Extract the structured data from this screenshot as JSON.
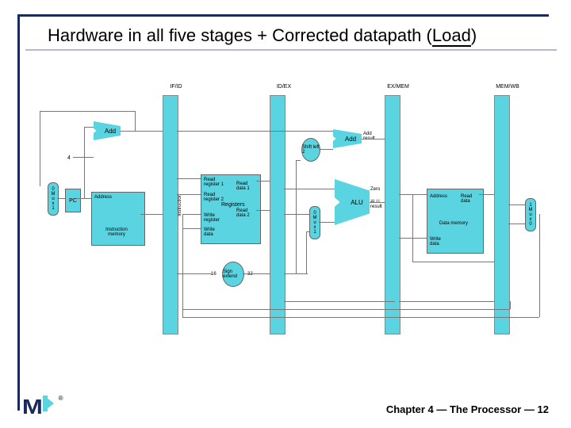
{
  "slide": {
    "title_prefix": "Hardware in all five stages + Corrected datapath (",
    "title_highlight": "Load",
    "title_suffix": ")",
    "footer": "Chapter 4 — The Processor — 12"
  },
  "pipeline": {
    "regs": [
      "IF/ID",
      "ID/EX",
      "EX/MEM",
      "MEM/WB"
    ]
  },
  "components": {
    "pc": "PC",
    "add1": "Add",
    "add2": "Add",
    "add_result": "Add result",
    "shift": "Shift left 2",
    "alu": "ALU",
    "alu_zero": "Zero",
    "alu_result": "ALU result",
    "instr_mem": "Instruction memory",
    "instr_mem_addr": "Address",
    "instr_label": "Instruction",
    "reg_file": "Registers",
    "reg_rd1": "Read register 1",
    "reg_rd2": "Read register 2",
    "reg_wr": "Write register",
    "reg_wd": "Write data",
    "reg_out1": "Read data 1",
    "reg_out2": "Read data 2",
    "data_mem": "Data memory",
    "data_mem_addr": "Address",
    "data_mem_rd": "Read data",
    "data_mem_wd": "Write data",
    "sign_ext": "Sign extend",
    "sign_in": "16",
    "sign_out": "32",
    "four": "4",
    "mux_0": "0",
    "mux_1": "1",
    "mux_m": "M",
    "mux_u": "u",
    "mux_x": "x"
  }
}
